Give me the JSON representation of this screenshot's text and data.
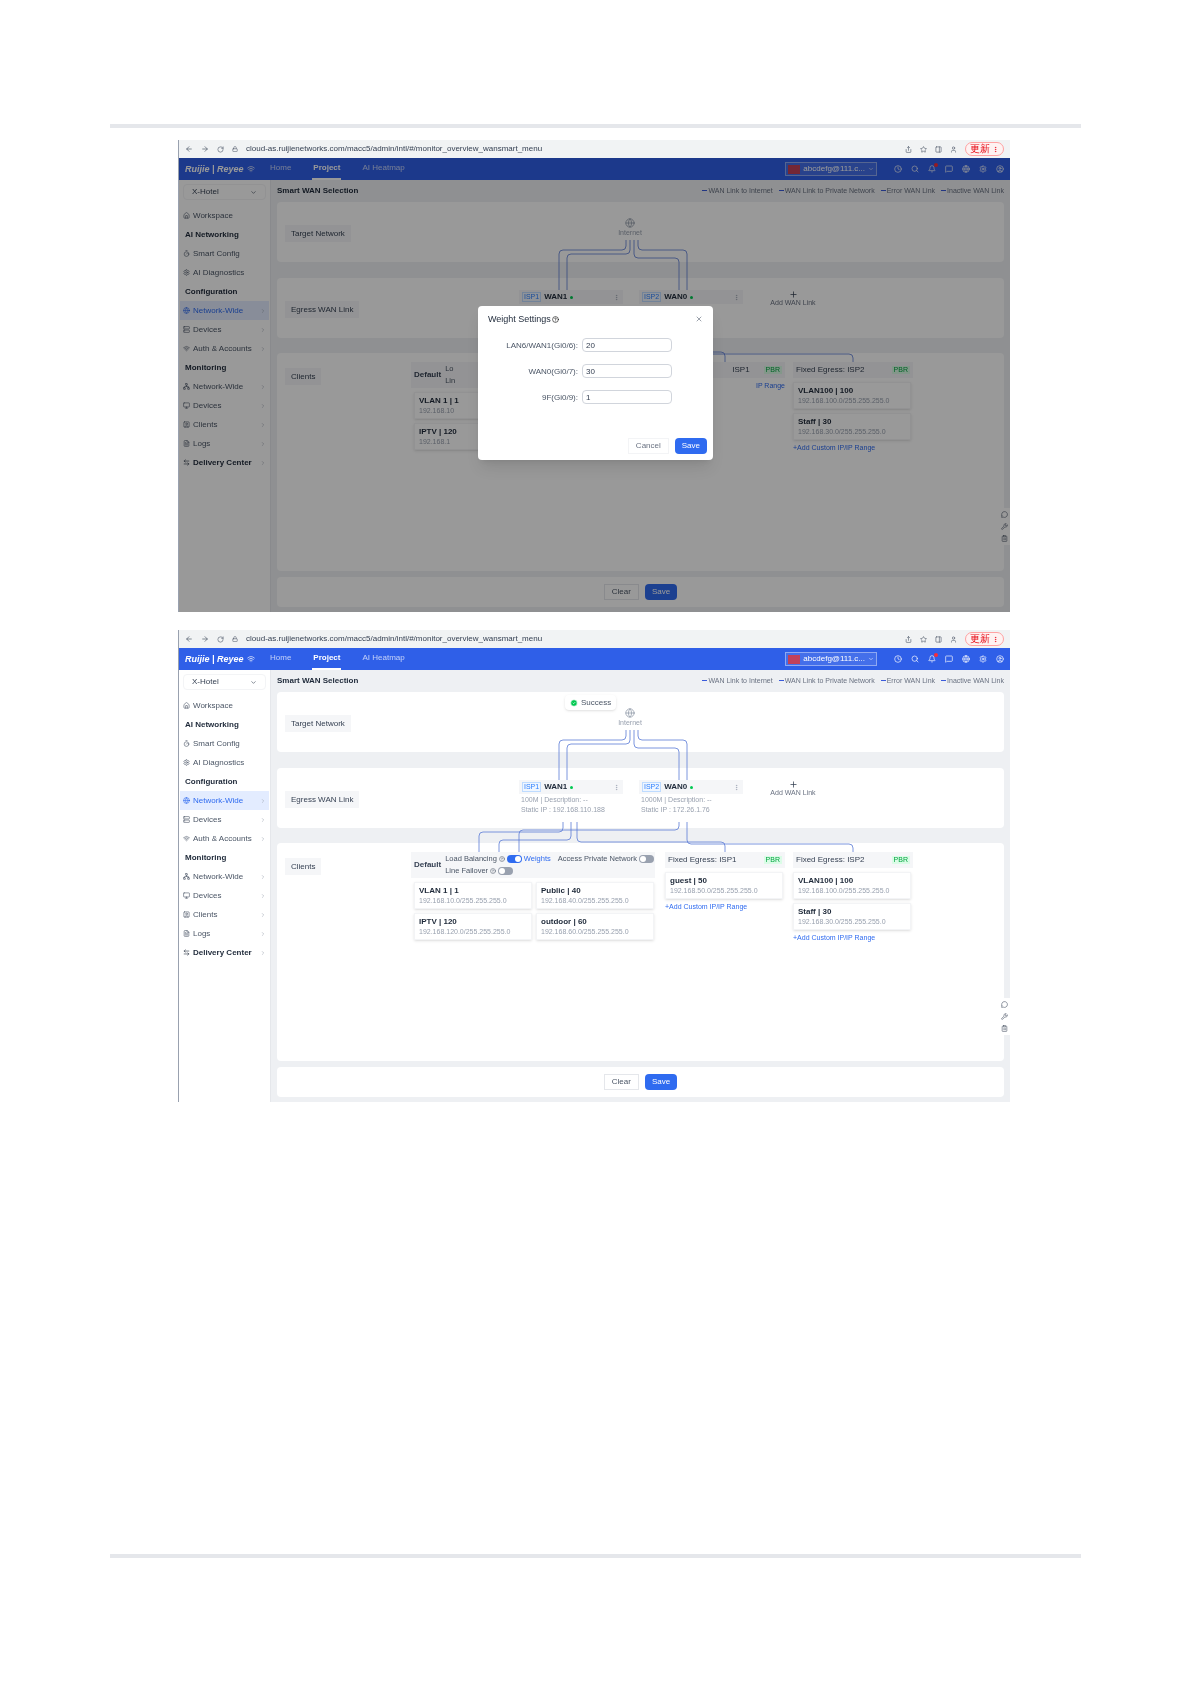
{
  "screenshots": [
    {
      "browser": {
        "url": "cloud-as.ruijienetworks.com/macc5/admin/intl/#/monitor_overview_wansmart_menu",
        "update_button": "更新"
      },
      "nav": {
        "logo": "Ruijie | Reyee",
        "tabs": [
          {
            "label": "Home",
            "selected": false
          },
          {
            "label": "Project",
            "selected": true
          },
          {
            "label": "AI Heatmap",
            "selected": false
          }
        ],
        "account": "abcdefg@111.c..."
      },
      "sidebar": [
        {
          "kind": "select",
          "label": "X-Hotel"
        },
        {
          "kind": "item",
          "label": "Workspace",
          "selected": false,
          "expandable": false
        },
        {
          "kind": "header",
          "label": "AI Networking"
        },
        {
          "kind": "item",
          "label": "Smart Config",
          "selected": false,
          "expandable": false
        },
        {
          "kind": "item",
          "label": "AI Diagnostics",
          "selected": false,
          "expandable": false
        },
        {
          "kind": "header",
          "label": "Configuration"
        },
        {
          "kind": "item",
          "label": "Network-Wide",
          "selected": true,
          "expandable": true
        },
        {
          "kind": "item",
          "label": "Devices",
          "selected": false,
          "expandable": true
        },
        {
          "kind": "item",
          "label": "Auth & Accounts",
          "selected": false,
          "expandable": true
        },
        {
          "kind": "header",
          "label": "Monitoring"
        },
        {
          "kind": "item",
          "label": "Network-Wide",
          "selected": false,
          "expandable": true
        },
        {
          "kind": "item",
          "label": "Devices",
          "selected": false,
          "expandable": true
        },
        {
          "kind": "item",
          "label": "Clients",
          "selected": false,
          "expandable": true
        },
        {
          "kind": "item",
          "label": "Logs",
          "selected": false,
          "expandable": true
        },
        {
          "kind": "strong-item",
          "label": "Delivery Center",
          "selected": false,
          "expandable": true
        }
      ],
      "title": "Smart WAN Selection",
      "legend": [
        "WAN Link to Internet",
        "WAN Link to Private Network",
        "Error WAN Link",
        "Inactive WAN Link"
      ],
      "target": {
        "label": "Target Network",
        "node": "Internet"
      },
      "egress": {
        "label": "Egress WAN Link",
        "links": [
          {
            "tag": "ISP1",
            "name": "WAN1",
            "online": true
          },
          {
            "tag": "ISP2",
            "name": "WAN0",
            "online": true
          }
        ],
        "add": "Add WAN Link"
      },
      "clients": {
        "label": "Clients",
        "default": {
          "label": "Default",
          "load_balancing": "Lo",
          "line_failover": "Lin",
          "rows": [
            [
              {
                "name": "VLAN 1 | 1",
                "ip": "192.168.10"
              }
            ],
            [
              {
                "name": "IPTV | 120",
                "ip": "192.168.1"
              }
            ]
          ]
        },
        "fixed": [
          {
            "kind": "partial",
            "title": "ISP1",
            "badge": "PBR",
            "add": "IP Range"
          },
          {
            "kind": "full",
            "title": "Fixed Egress: ISP2",
            "badge": "PBR",
            "entries": [
              {
                "name": "VLAN100 | 100",
                "ip": "192.168.100.0/255.255.255.0"
              },
              {
                "name": "Staff | 30",
                "ip": "192.168.30.0/255.255.255.0"
              }
            ],
            "add": "+Add Custom IP/IP Range"
          }
        ]
      },
      "footer": {
        "clear": "Clear",
        "save": "Save"
      },
      "modal": {
        "title": "Weight Settings",
        "fields": [
          {
            "label": "LAN6/WAN1(Gi0/6):",
            "value": "20"
          },
          {
            "label": "WAN0(Gi0/7):",
            "value": "30"
          },
          {
            "label": "9F(Gi0/9):",
            "value": "1"
          }
        ],
        "cancel": "Cancel",
        "save": "Save"
      }
    },
    {
      "browser": {
        "url": "cloud-as.ruijienetworks.com/macc5/admin/intl/#/monitor_overview_wansmart_menu",
        "update_button": "更新"
      },
      "nav": {
        "logo": "Ruijie | Reyee",
        "tabs": [
          {
            "label": "Home",
            "selected": false
          },
          {
            "label": "Project",
            "selected": true
          },
          {
            "label": "AI Heatmap",
            "selected": false
          }
        ],
        "account": "abcdefg@111.c..."
      },
      "sidebar": [
        {
          "kind": "select",
          "label": "X-Hotel"
        },
        {
          "kind": "item",
          "label": "Workspace",
          "selected": false,
          "expandable": false
        },
        {
          "kind": "header",
          "label": "AI Networking"
        },
        {
          "kind": "item",
          "label": "Smart Config",
          "selected": false,
          "expandable": false
        },
        {
          "kind": "item",
          "label": "AI Diagnostics",
          "selected": false,
          "expandable": false
        },
        {
          "kind": "header",
          "label": "Configuration"
        },
        {
          "kind": "item",
          "label": "Network-Wide",
          "selected": true,
          "expandable": true
        },
        {
          "kind": "item",
          "label": "Devices",
          "selected": false,
          "expandable": true
        },
        {
          "kind": "item",
          "label": "Auth & Accounts",
          "selected": false,
          "expandable": true
        },
        {
          "kind": "header",
          "label": "Monitoring"
        },
        {
          "kind": "item",
          "label": "Network-Wide",
          "selected": false,
          "expandable": true
        },
        {
          "kind": "item",
          "label": "Devices",
          "selected": false,
          "expandable": true
        },
        {
          "kind": "item",
          "label": "Clients",
          "selected": false,
          "expandable": true
        },
        {
          "kind": "item",
          "label": "Logs",
          "selected": false,
          "expandable": true
        },
        {
          "kind": "strong-item",
          "label": "Delivery Center",
          "selected": false,
          "expandable": true
        }
      ],
      "title": "Smart WAN Selection",
      "legend": [
        "WAN Link to Internet",
        "WAN Link to Private Network",
        "Error WAN Link",
        "Inactive WAN Link"
      ],
      "toast": "Success",
      "target": {
        "label": "Target Network",
        "node": "Internet"
      },
      "egress": {
        "label": "Egress WAN Link",
        "links": [
          {
            "tag": "ISP1",
            "name": "WAN1",
            "online": true,
            "lines": [
              "100M | Description: --",
              "Static IP : 192.168.110.188"
            ]
          },
          {
            "tag": "ISP2",
            "name": "WAN0",
            "online": true,
            "lines": [
              "1000M | Description: --",
              "Static IP : 172.26.1.76"
            ]
          }
        ],
        "add": "Add WAN Link"
      },
      "clients": {
        "label": "Clients",
        "default": {
          "label": "Default",
          "load_balancing": "Load Balancing",
          "lb_on": true,
          "weights": "Weights",
          "access_private": "Access Private Network",
          "ap_on": false,
          "line_failover": "Line Failover",
          "lf_on": false,
          "rows": [
            [
              {
                "name": "VLAN 1 | 1",
                "ip": "192.168.10.0/255.255.255.0"
              },
              {
                "name": "Public | 40",
                "ip": "192.168.40.0/255.255.255.0"
              }
            ],
            [
              {
                "name": "IPTV | 120",
                "ip": "192.168.120.0/255.255.255.0"
              },
              {
                "name": "outdoor | 60",
                "ip": "192.168.60.0/255.255.255.0"
              }
            ]
          ]
        },
        "fixed": [
          {
            "kind": "full",
            "title": "Fixed Egress: ISP1",
            "badge": "PBR",
            "entries": [
              {
                "name": "guest | 50",
                "ip": "192.168.50.0/255.255.255.0"
              }
            ],
            "add": "+Add Custom IP/IP Range"
          },
          {
            "kind": "full",
            "title": "Fixed Egress: ISP2",
            "badge": "PBR",
            "entries": [
              {
                "name": "VLAN100 | 100",
                "ip": "192.168.100.0/255.255.255.0"
              },
              {
                "name": "Staff | 30",
                "ip": "192.168.30.0/255.255.255.0"
              }
            ],
            "add": "+Add Custom IP/IP Range"
          }
        ]
      },
      "footer": {
        "clear": "Clear",
        "save": "Save"
      }
    }
  ]
}
